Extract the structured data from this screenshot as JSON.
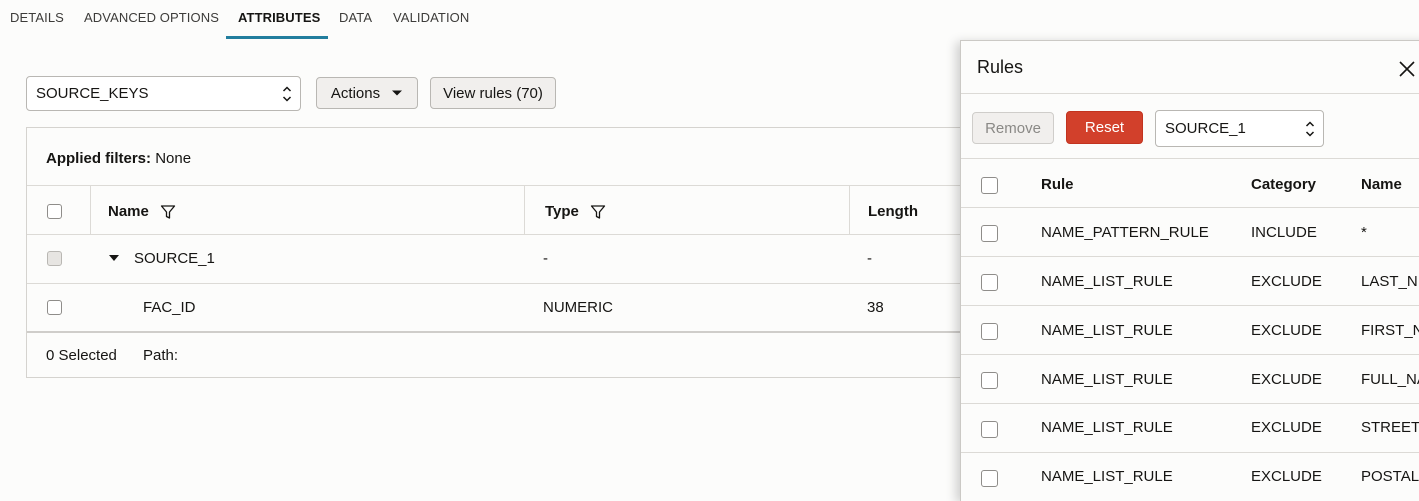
{
  "tabs": [
    "DETAILS",
    "ADVANCED OPTIONS",
    "ATTRIBUTES",
    "DATA",
    "VALIDATION"
  ],
  "active_tab": "ATTRIBUTES",
  "toolbar": {
    "entity_select_value": "SOURCE_KEYS",
    "actions_label": "Actions",
    "view_rules_label": "View rules (70)"
  },
  "filters": {
    "label": "Applied filters:",
    "value": "None"
  },
  "table": {
    "headers": {
      "name": "Name",
      "type": "Type",
      "length": "Length"
    },
    "rows": [
      {
        "name": "SOURCE_1",
        "type": "-",
        "length": "-",
        "expanded": true
      },
      {
        "name": "FAC_ID",
        "type": "NUMERIC",
        "length": "38"
      }
    ],
    "footer": {
      "selected": "0 Selected",
      "path": "Path:"
    }
  },
  "drawer": {
    "title": "Rules",
    "remove_label": "Remove",
    "reset_label": "Reset",
    "source_select_value": "SOURCE_1",
    "headers": {
      "rule": "Rule",
      "category": "Category",
      "name": "Name"
    },
    "rows": [
      {
        "rule": "NAME_PATTERN_RULE",
        "category": "INCLUDE",
        "name": "*"
      },
      {
        "rule": "NAME_LIST_RULE",
        "category": "EXCLUDE",
        "name": "LAST_N"
      },
      {
        "rule": "NAME_LIST_RULE",
        "category": "EXCLUDE",
        "name": "FIRST_N"
      },
      {
        "rule": "NAME_LIST_RULE",
        "category": "EXCLUDE",
        "name": "FULL_NA"
      },
      {
        "rule": "NAME_LIST_RULE",
        "category": "EXCLUDE",
        "name": "STREET"
      },
      {
        "rule": "NAME_LIST_RULE",
        "category": "EXCLUDE",
        "name": "POSTAL"
      }
    ]
  },
  "colors": {
    "accent": "#227e9e",
    "danger": "#d2402b"
  }
}
